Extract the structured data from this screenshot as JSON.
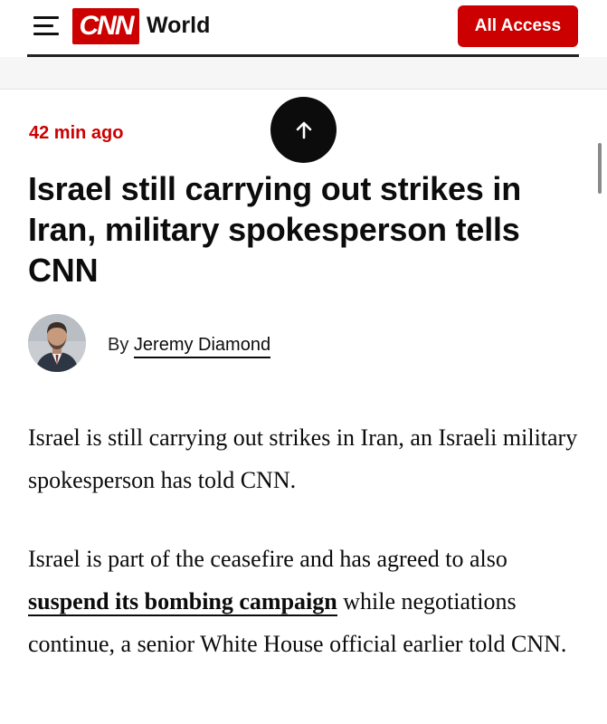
{
  "header": {
    "logo_text": "CNN",
    "section": "World",
    "all_access_label": "All Access"
  },
  "article": {
    "timestamp": "42 min ago",
    "headline": "Israel still carrying out strikes in Iran, military spokesperson tells CNN",
    "byline_prefix": "By",
    "author": "Jeremy Diamond",
    "paragraph1": "Israel is still carrying out strikes in Iran, an Israeli military spokesperson has told CNN.",
    "paragraph2_before": "Israel is part of the ceasefire and has agreed to also ",
    "paragraph2_link": "suspend its bombing campaign",
    "paragraph2_after": " while negotiations continue, a senior White House official earlier told CNN."
  },
  "icons": {
    "menu": "hamburger-menu-icon",
    "scroll_top": "arrow-up-icon",
    "author_photo": "author-avatar"
  },
  "colors": {
    "brand_red": "#cc0000",
    "text": "#0c0c0c",
    "scroll_button": "#0c0c0c"
  }
}
